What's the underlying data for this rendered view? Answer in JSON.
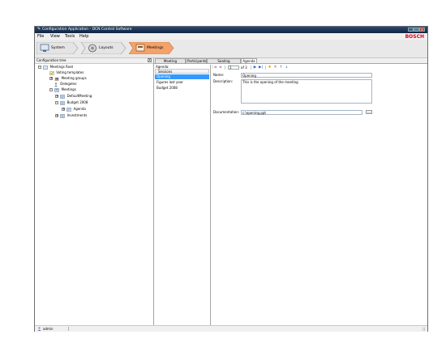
{
  "window": {
    "title": "Configuration Application - DCN Control Software",
    "brand": "BOSCH",
    "controls": {
      "minimize": "_",
      "maximize": "□",
      "close": "×"
    }
  },
  "menu": [
    "File",
    "View",
    "Tools",
    "Help"
  ],
  "breadcrumb": [
    {
      "label": "System",
      "icon": "system-icon"
    },
    {
      "label": "Layouts",
      "icon": "layouts-icon"
    },
    {
      "label": "Meetings",
      "icon": "meetings-icon",
      "active": true
    }
  ],
  "left_pane": {
    "title": "Configuration tree",
    "pin": "X",
    "tree": [
      {
        "label": "Meetings Root",
        "expander": "-",
        "icon": "meetings-root-icon"
      },
      {
        "label": "Voting templates",
        "icon": "voting-templates-icon"
      },
      {
        "label": "Meeting groups",
        "expander": "+",
        "icon": "meeting-groups-icon"
      },
      {
        "label": "Delegates",
        "icon": "delegates-icon"
      },
      {
        "label": "Meetings",
        "expander": "-",
        "icon": "meetings-folder-icon"
      },
      {
        "label": "DefaultMeeting",
        "expander": "+",
        "icon": "meeting-icon"
      },
      {
        "label": "Budget 2008",
        "expander": "-",
        "icon": "meeting-icon",
        "selected": true
      },
      {
        "label": "Agenda",
        "expander": "+",
        "icon": "agenda-icon"
      },
      {
        "label": "Investments",
        "expander": "+",
        "icon": "meeting-icon"
      }
    ]
  },
  "tabs": [
    "Meeting Information",
    "Participants",
    "Seating arrangement",
    "Agenda"
  ],
  "active_tab": "Agenda",
  "agenda": {
    "header": "Agenda:",
    "column": "Sessions",
    "items": [
      "Opening",
      "Figures last year",
      "Budget 2008"
    ],
    "selected": "Opening"
  },
  "navigator": {
    "position": "1",
    "of_label": "of 3",
    "first": "|◀",
    "prev": "◀",
    "next": "▶",
    "last": "▶|",
    "add": "✚",
    "delete": "✕",
    "move_up": "↑",
    "move_down": "↓"
  },
  "details": {
    "name_label": "Name:",
    "name_value": "Opening",
    "description_label": "Description:",
    "description_value": "This is the opening of the meeting",
    "documentation_label": "Documentation:",
    "documentation_value": "c:\\opening.ppt",
    "browse": "..."
  },
  "status": {
    "user": "admin",
    "grip": "||"
  },
  "colors": {
    "titlebar": "#1f3a5f",
    "brand": "#e2001a",
    "selection": "#3399ff",
    "active_crumb": "#f4a26a"
  }
}
